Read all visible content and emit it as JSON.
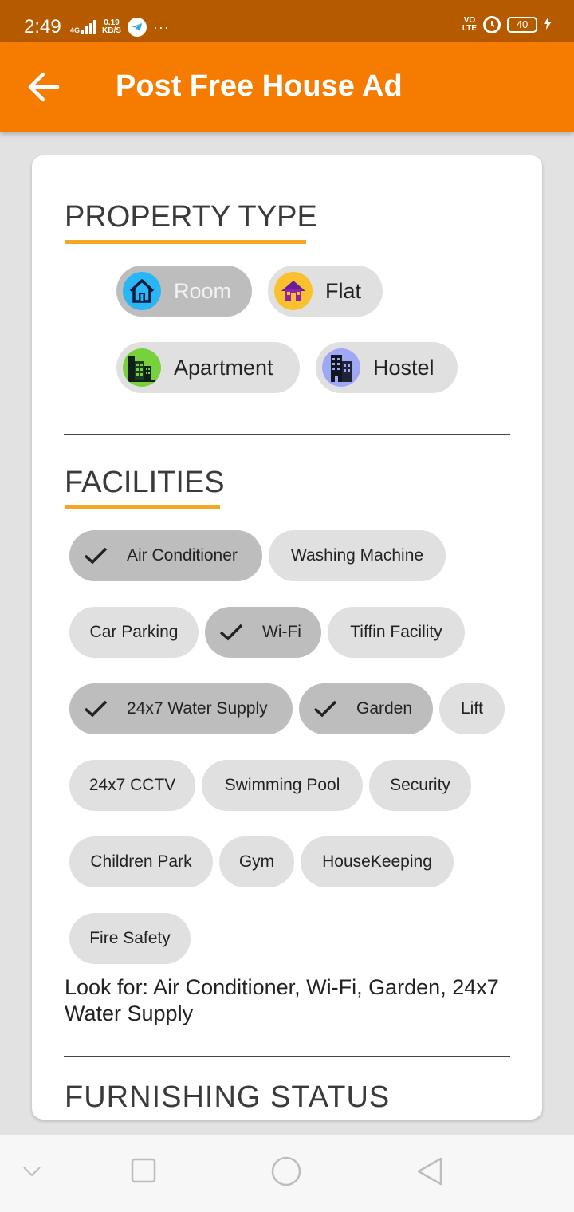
{
  "status_bar": {
    "time": "2:49",
    "network": "4G",
    "speed_value": "0.19",
    "speed_unit": "KB/S",
    "more": "···",
    "volte_top": "VO",
    "volte_bottom": "LTE",
    "battery": "40"
  },
  "app_bar": {
    "title": "Post Free House Ad",
    "back_icon": "arrow-left-icon"
  },
  "property_type": {
    "title": "PROPERTY TYPE",
    "options": [
      {
        "label": "Room",
        "selected": true,
        "icon": "home-icon",
        "icon_bg": "#29b6f6"
      },
      {
        "label": "Flat",
        "selected": false,
        "icon": "house-icon",
        "icon_bg": "#fbc02d"
      },
      {
        "label": "Apartment",
        "selected": false,
        "icon": "apartment-icon",
        "icon_bg": "#76d13b"
      },
      {
        "label": "Hostel",
        "selected": false,
        "icon": "hostel-icon",
        "icon_bg": "#9fa8f5"
      }
    ]
  },
  "facilities": {
    "title": "FACILITIES",
    "chips": [
      {
        "label": "Air Conditioner",
        "selected": true
      },
      {
        "label": "Washing Machine",
        "selected": false
      },
      {
        "label": "Car Parking",
        "selected": false
      },
      {
        "label": "Wi-Fi",
        "selected": true
      },
      {
        "label": "Tiffin Facility",
        "selected": false
      },
      {
        "label": "24x7 Water Supply",
        "selected": true
      },
      {
        "label": "Garden",
        "selected": true
      },
      {
        "label": "Lift",
        "selected": false
      },
      {
        "label": "24x7 CCTV",
        "selected": false
      },
      {
        "label": "Swimming Pool",
        "selected": false
      },
      {
        "label": "Security",
        "selected": false
      },
      {
        "label": "Children Park",
        "selected": false
      },
      {
        "label": "Gym",
        "selected": false
      },
      {
        "label": "HouseKeeping",
        "selected": false
      },
      {
        "label": "Fire Safety",
        "selected": false
      }
    ],
    "look_for": "Look for: Air Conditioner, Wi-Fi, Garden, 24x7 Water Supply"
  },
  "next_section_title": "FURNISHING STATUS",
  "colors": {
    "status_bar": "#b65a00",
    "app_bar": "#f57c00",
    "accent_underline": "#f5a623",
    "chip": "#e0e0e0",
    "chip_selected": "#bdbdbd"
  },
  "nav_bar": {
    "icons": [
      "chevron-down-icon",
      "recents-square-icon",
      "home-circle-icon",
      "back-triangle-icon"
    ]
  }
}
